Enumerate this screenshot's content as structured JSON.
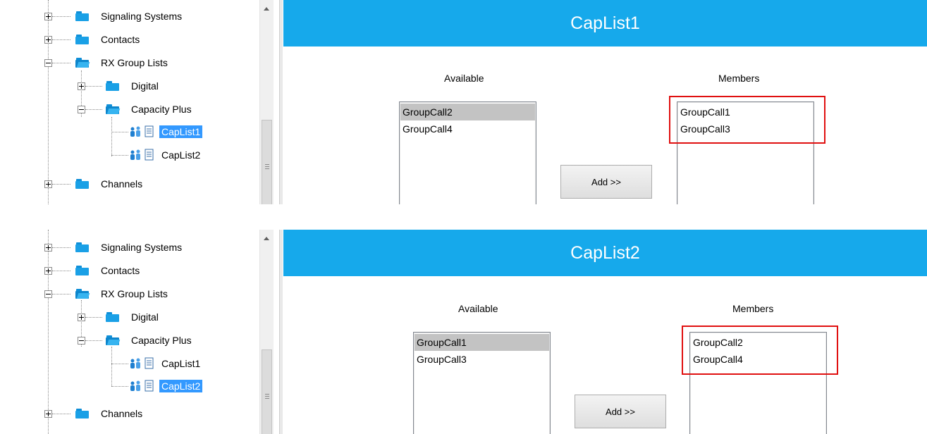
{
  "tree": {
    "items": {
      "signaling": "Signaling Systems",
      "contacts": "Contacts",
      "rx_group_lists": "RX Group Lists",
      "digital": "Digital",
      "capacity_plus": "Capacity Plus",
      "caplist1": "CapList1",
      "caplist2": "CapList2",
      "channels": "Channels"
    }
  },
  "panels": [
    {
      "selected_tree_item": "CapList1",
      "title": "CapList1",
      "available_label": "Available",
      "members_label": "Members",
      "available": [
        "GroupCall2",
        "GroupCall4"
      ],
      "members": [
        "GroupCall1",
        "GroupCall3"
      ],
      "add_button": "Add >>"
    },
    {
      "selected_tree_item": "CapList2",
      "title": "CapList2",
      "available_label": "Available",
      "members_label": "Members",
      "available": [
        "GroupCall1",
        "GroupCall3"
      ],
      "members": [
        "GroupCall2",
        "GroupCall4"
      ],
      "add_button": "Add >>"
    }
  ],
  "colors": {
    "title_bar": "#16a9eb",
    "tree_selection": "#3399ff",
    "highlight_box": "#e01010",
    "list_selection": "#c3c3c3"
  }
}
